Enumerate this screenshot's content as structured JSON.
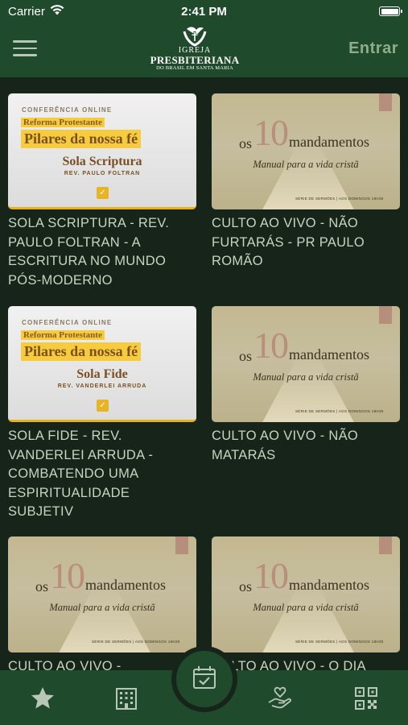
{
  "status_bar": {
    "carrier": "Carrier",
    "time": "2:41 PM"
  },
  "header": {
    "logo": {
      "line1": "IGREJA",
      "line2": "PRESBITERIANA",
      "line3": "DO BRASIL EM SANTA MARIA"
    },
    "login_label": "Entrar"
  },
  "thumbnails": {
    "conference": {
      "header": "CONFERÊNCIA ONLINE",
      "subtitle": "Reforma Protestante",
      "title": "Pilares da nossa fé"
    },
    "mandamentos": {
      "os": "os",
      "number": "10",
      "word": "mandamentos",
      "subtitle": "Manual para a vida cristã",
      "footer": "SÉRIE DE SERMÕES | AOS DOMINGOS 18H30"
    }
  },
  "videos": [
    {
      "title": "SOLA SCRIPTURA - REV. PAULO FOLTRAN - A ESCRITURA NO MUNDO PÓS-MODERNO",
      "thumb": "conference",
      "sola": "Sola Scriptura",
      "rev": "REV. PAULO FOLTRAN"
    },
    {
      "title": "CULTO AO VIVO - NÃO FURTARÁS - PR PAULO ROMÃO",
      "thumb": "mandamentos"
    },
    {
      "title": "SOLA FIDE - REV. VANDERLEI ARRUDA - COMBATENDO UMA ESPIRITUALIDADE SUBJETIV",
      "thumb": "conference",
      "sola": "Sola Fide",
      "rev": "REV. VANDERLEI ARRUDA"
    },
    {
      "title": "CULTO AO VIVO - NÃO MATARÁS",
      "thumb": "mandamentos"
    },
    {
      "title": "CULTO AO VIVO -",
      "thumb": "mandamentos"
    },
    {
      "title": "CULTO AO VIVO - O DIA",
      "thumb": "mandamentos"
    }
  ],
  "tab_bar": {
    "items": [
      {
        "icon": "star-icon"
      },
      {
        "icon": "building-icon"
      },
      {
        "icon": "calendar-check-icon",
        "active": true
      },
      {
        "icon": "heart-hand-icon"
      },
      {
        "icon": "qr-code-icon"
      }
    ]
  },
  "colors": {
    "background": "#172419",
    "bar": "#1f4a2b",
    "text": "#c3d6c1",
    "accent": "#8fad8a",
    "gold": "#f6cc3e"
  }
}
